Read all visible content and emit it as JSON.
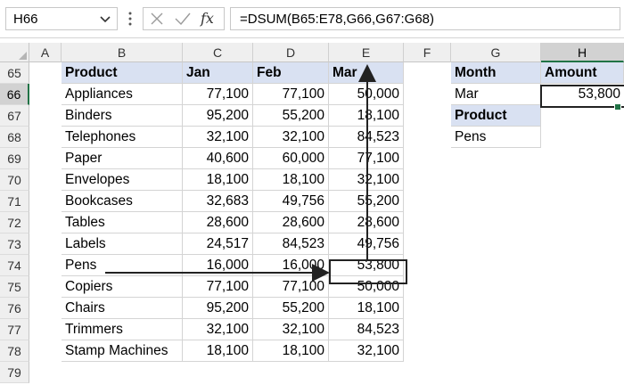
{
  "formula_bar": {
    "name_box": "H66",
    "formula": "=DSUM(B65:E78,G66,G67:G68)",
    "fx_label": "fx"
  },
  "columns": [
    "A",
    "B",
    "C",
    "D",
    "E",
    "F",
    "G",
    "H"
  ],
  "selected_column": "H",
  "rows": [
    "65",
    "66",
    "67",
    "68",
    "69",
    "70",
    "71",
    "72",
    "73",
    "74",
    "75",
    "76",
    "77",
    "78",
    "79"
  ],
  "selected_row": "66",
  "table": {
    "headers": [
      "Product",
      "Jan",
      "Feb",
      "Mar"
    ],
    "rows": [
      [
        "Appliances",
        "77,100",
        "77,100",
        "50,000"
      ],
      [
        "Binders",
        "95,200",
        "55,200",
        "18,100"
      ],
      [
        "Telephones",
        "32,100",
        "32,100",
        "84,523"
      ],
      [
        "Paper",
        "40,600",
        "60,000",
        "77,100"
      ],
      [
        "Envelopes",
        "18,100",
        "18,100",
        "32,100"
      ],
      [
        "Bookcases",
        "32,683",
        "49,756",
        "55,200"
      ],
      [
        "Tables",
        "28,600",
        "28,600",
        "28,600"
      ],
      [
        "Labels",
        "24,517",
        "84,523",
        "49,756"
      ],
      [
        "Pens",
        "16,000",
        "16,000",
        "53,800"
      ],
      [
        "Copiers",
        "77,100",
        "77,100",
        "50,000"
      ],
      [
        "Chairs",
        "95,200",
        "55,200",
        "18,100"
      ],
      [
        "Trimmers",
        "32,100",
        "32,100",
        "84,523"
      ],
      [
        "Stamp Machines",
        "18,100",
        "18,100",
        "32,100"
      ]
    ]
  },
  "criteria": {
    "month_header": "Month",
    "month_value": "Mar",
    "product_header": "Product",
    "product_value": "Pens",
    "amount_header": "Amount",
    "amount_value": "53,800"
  },
  "colors": {
    "header_fill": "#d9e1f2",
    "selection_accent": "#217346"
  }
}
